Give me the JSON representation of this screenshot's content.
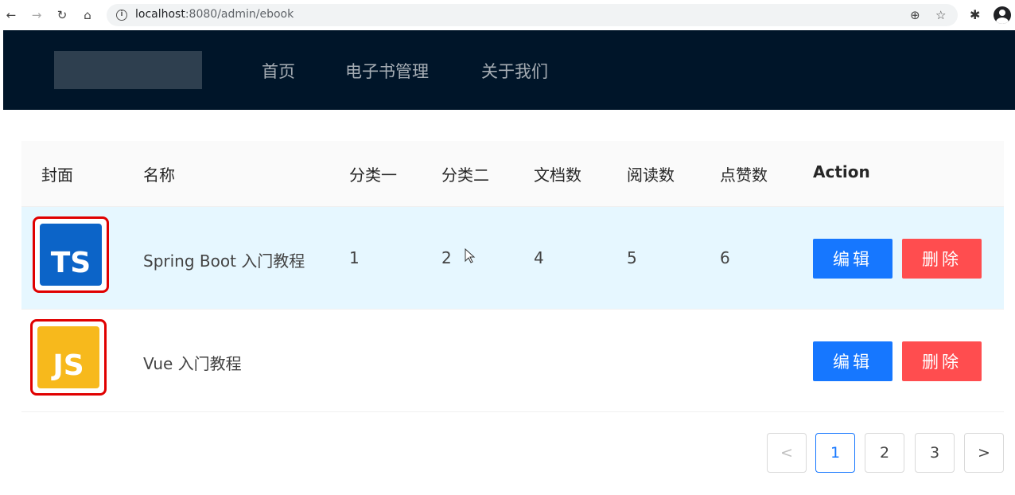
{
  "browser": {
    "url_host": "localhost",
    "url_rest": ":8080/admin/ebook"
  },
  "header": {
    "menu": [
      "首页",
      "电子书管理",
      "关于我们"
    ]
  },
  "table": {
    "columns": [
      "封面",
      "名称",
      "分类一",
      "分类二",
      "文档数",
      "阅读数",
      "点赞数",
      "Action"
    ],
    "rows": [
      {
        "cover": "TS",
        "name": "Spring Boot 入门教程",
        "category1": "1",
        "category2": "2",
        "docs": "4",
        "views": "5",
        "votes": "6",
        "edit": "编辑",
        "delete": "删除"
      },
      {
        "cover": "JS",
        "name": "Vue 入门教程",
        "category1": "",
        "category2": "",
        "docs": "",
        "views": "",
        "votes": "",
        "edit": "编辑",
        "delete": "删除"
      }
    ]
  },
  "pagination": {
    "prev": "<",
    "pages": [
      "1",
      "2",
      "3"
    ],
    "current": "1",
    "next": ">"
  },
  "colors": {
    "header_bg": "#001529",
    "primary": "#1677ff",
    "danger": "#ff4d4f",
    "row_highlight": "#e6f7ff"
  }
}
